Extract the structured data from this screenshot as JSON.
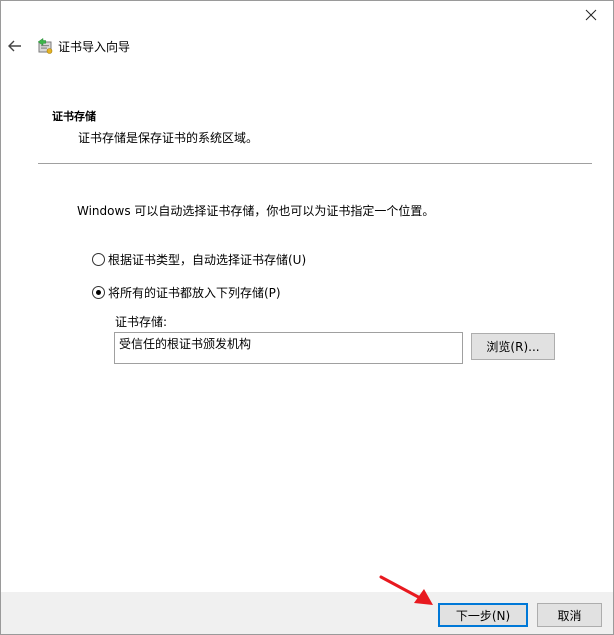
{
  "window": {
    "title": "证书导入向导",
    "close_icon": "close-icon",
    "back_icon": "back-arrow-icon",
    "wizard_icon": "certificate-import-icon"
  },
  "section": {
    "heading": "证书存储",
    "description": "证书存储是保存证书的系统区域。"
  },
  "intro": "Windows 可以自动选择证书存储，你也可以为证书指定一个位置。",
  "options": [
    {
      "label": "根据证书类型，自动选择证书存储(U)",
      "checked": false
    },
    {
      "label": "将所有的证书都放入下列存储(P)",
      "checked": true
    }
  ],
  "store": {
    "label": "证书存储:",
    "value": "受信任的根证书颁发机构",
    "browse_label": "浏览(R)..."
  },
  "footer": {
    "next_label": "下一步(N)",
    "cancel_label": "取消"
  },
  "colors": {
    "accent": "#0078d7",
    "annotation_arrow": "#e8191f",
    "footer_bg": "#f0f0f0"
  }
}
